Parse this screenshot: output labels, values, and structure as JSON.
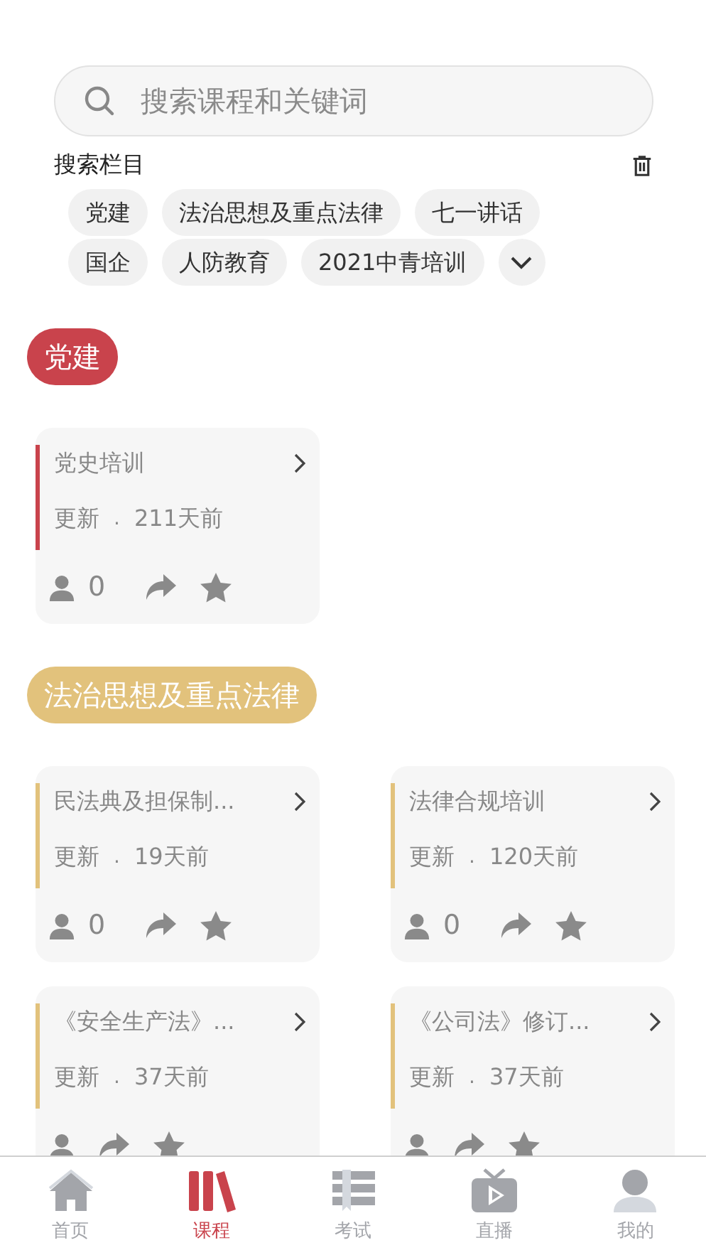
{
  "search": {
    "placeholder": "搜索课程和关键词"
  },
  "tags_section": {
    "title": "搜索栏目",
    "tags": [
      "党建",
      "法治思想及重点法律",
      "七一讲话",
      "国企",
      "人防教育",
      "2021中青培训"
    ]
  },
  "sections": [
    {
      "title": "党建",
      "color": "#c9434c",
      "courses": [
        {
          "title": "党史培训",
          "update_label": "更新",
          "separator": ".",
          "age": "211天前",
          "count": "0"
        }
      ]
    },
    {
      "title": "法治思想及重点法律",
      "color": "#e2c27c",
      "courses": [
        {
          "title": "民法典及担保制...",
          "update_label": "更新",
          "separator": ".",
          "age": "19天前",
          "count": "0"
        },
        {
          "title": "法律合规培训",
          "update_label": "更新",
          "separator": ".",
          "age": "120天前",
          "count": "0"
        },
        {
          "title": "《安全生产法》...",
          "update_label": "更新",
          "separator": ".",
          "age": "37天前"
        },
        {
          "title": "《公司法》修订...",
          "update_label": "更新",
          "separator": ".",
          "age": "37天前"
        }
      ]
    }
  ],
  "tab_bar": [
    {
      "label": "首页",
      "kind": "home",
      "selected": false
    },
    {
      "label": "课程",
      "kind": "courses",
      "selected": true
    },
    {
      "label": "考试",
      "kind": "exam",
      "selected": false
    },
    {
      "label": "直播",
      "kind": "live",
      "selected": false
    },
    {
      "label": "我的",
      "kind": "profile",
      "selected": false
    }
  ]
}
